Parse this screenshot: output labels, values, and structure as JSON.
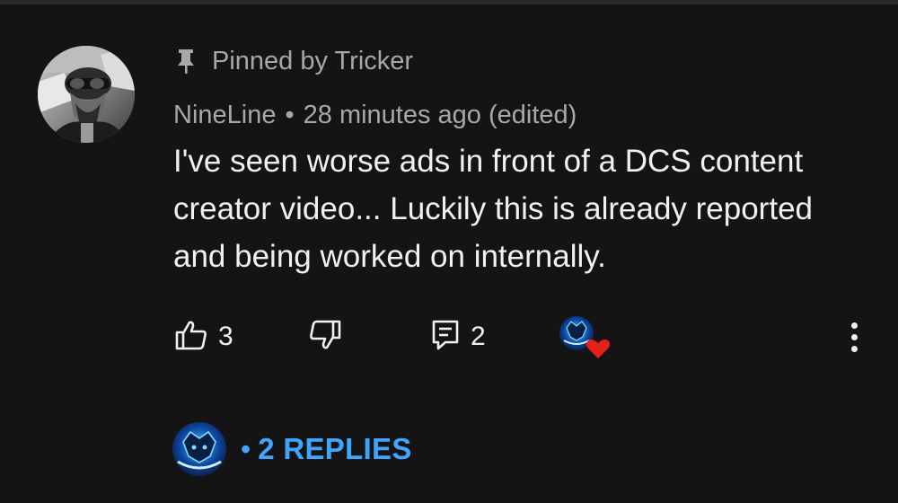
{
  "comment": {
    "pinned_text": "Pinned by Tricker",
    "author": "NineLine",
    "separator": "•",
    "timestamp": "28 minutes ago (edited)",
    "body": "I've seen worse ads in front of a DCS content creator video... Luckily this is already reported and being worked on internally."
  },
  "actions": {
    "like_count": "3",
    "reply_count": "2",
    "like_icon": "thumbs-up-icon",
    "dislike_icon": "thumbs-down-icon",
    "reply_icon": "comment-icon",
    "more_icon": "more-vertical-icon",
    "heart_color": "#e62117"
  },
  "replies": {
    "dot": "•",
    "label": "2 REPLIES",
    "color": "#3ea6ff"
  }
}
